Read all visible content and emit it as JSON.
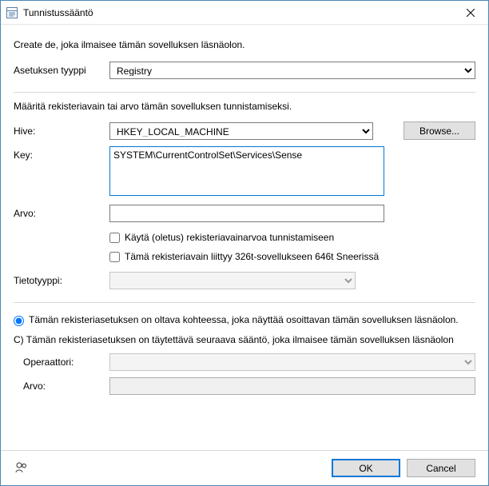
{
  "window": {
    "title": "Tunnistussääntö"
  },
  "desc": "Create de, joka ilmaisee tämän sovelluksen läsnäolon.",
  "settingType": {
    "label": "Asetuksen tyyppi",
    "value": "Registry"
  },
  "subdesc": "Määritä rekisteriavain tai arvo tämän sovelluksen tunnistamiseksi.",
  "hive": {
    "label": "Hive:",
    "value": "HKEY_LOCAL_MACHINE",
    "browse": "Browse..."
  },
  "key": {
    "label": "Key:",
    "value": "SYSTEM\\CurrentControlSet\\Services\\Sense"
  },
  "arvo": {
    "label": "Arvo:",
    "value": ""
  },
  "chk1": "Käytä (oletus) rekisteriavainarvoa tunnistamiseen",
  "chk2": "Tämä rekisteriavain liittyy 326t-sovellukseen 646t Sneerissä",
  "tietotyyppi": {
    "label": "Tietotyyppi:",
    "value": ""
  },
  "radio1": "Tämän rekisteriasetuksen on oltava kohteessa, joka näyttää osoittavan tämän sovelluksen läsnäolon.",
  "cline": "C) Tämän rekisteriasetuksen on täytettävä seuraava sääntö, joka ilmaisee tämän sovelluksen läsnäolon",
  "operaattori": {
    "label": "Operaattori:",
    "value": ""
  },
  "arvo2": {
    "label": "Arvo:",
    "value": ""
  },
  "footer": {
    "ok": "OK",
    "cancel": "Cancel"
  }
}
